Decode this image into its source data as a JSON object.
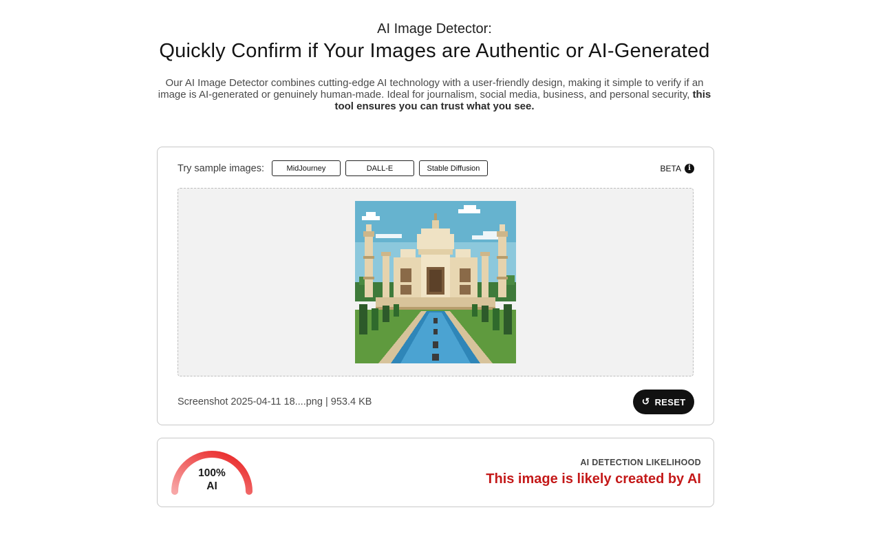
{
  "header": {
    "eyebrow": "AI Image Detector:",
    "headline": "Quickly Confirm if Your Images are Authentic or AI-Generated",
    "intro": "Our AI Image Detector combines cutting-edge AI technology with a user-friendly design, making it simple to verify if an image is AI-generated or genuinely human-made. Ideal for journalism, social media, business, and personal security,",
    "intro_bold": "this tool ensures you can trust what you see."
  },
  "upload": {
    "samples_label": "Try sample images:",
    "samples": [
      "MidJourney",
      "DALL-E",
      "Stable Diffusion"
    ],
    "beta_label": "BETA",
    "info_icon": "info-icon",
    "preview_subject": "pixel-art Taj Mahal",
    "file_info": "Screenshot 2025-04-11 18....png | 953.4 KB",
    "reset_label": "RESET",
    "reset_icon": "rotate-ccw-icon"
  },
  "result": {
    "percent_value": 100,
    "percent_text": "100%",
    "type_text": "AI",
    "label": "AI DETECTION LIKELIHOOD",
    "verdict": "This image is likely created by AI",
    "colors": {
      "verdict": "#c41919",
      "gauge_start": "#f7a6a6",
      "gauge_end": "#e81e1e"
    }
  }
}
